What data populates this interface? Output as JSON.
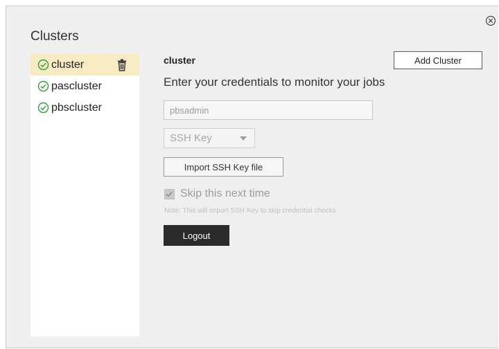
{
  "sidebar": {
    "title": "Clusters",
    "items": [
      {
        "label": "cluster",
        "status": "connected",
        "selected": true
      },
      {
        "label": "pascluster",
        "status": "connected",
        "selected": false
      },
      {
        "label": "pbscluster",
        "status": "connected",
        "selected": false
      }
    ]
  },
  "main": {
    "cluster_name": "cluster",
    "add_cluster_label": "Add Cluster",
    "heading": "Enter your credentials to monitor your jobs",
    "username_value": "pbsadmin",
    "auth_method_selected": "SSH Key",
    "import_button_label": "Import SSH Key file",
    "skip_checkbox_label": "Skip this next time",
    "skip_checked": true,
    "skip_note": "Note: This will import SSH Key to skip credential checks",
    "logout_label": "Logout"
  },
  "icons": {
    "close": "close-circle-icon",
    "status": "check-circle-icon",
    "delete": "trash-icon"
  },
  "colors": {
    "selected_row": "#f7ebc4",
    "status_green": "#2e9e3a",
    "logout_bg": "#2a2a2a",
    "dialog_bg": "#efefef"
  }
}
